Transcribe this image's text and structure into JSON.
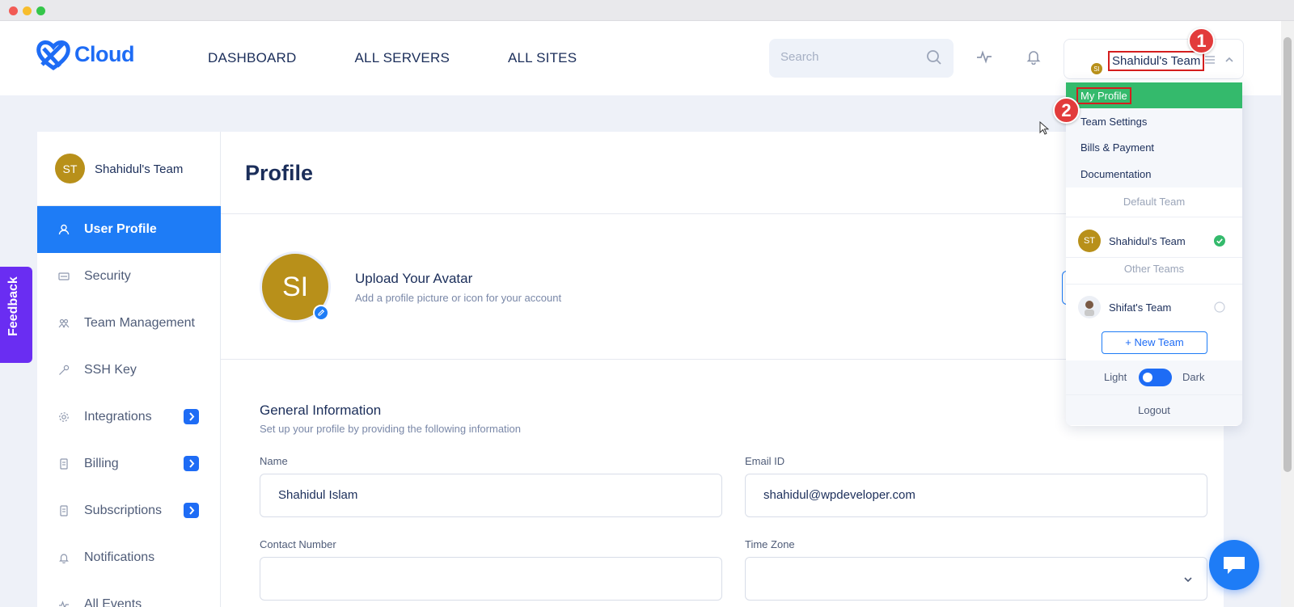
{
  "app": {
    "logo_text": "Cloud"
  },
  "nav": [
    {
      "label": "DASHBOARD"
    },
    {
      "label": "ALL SERVERS"
    },
    {
      "label": "ALL SITES"
    }
  ],
  "search": {
    "placeholder": "Search"
  },
  "user": {
    "initials": "ST",
    "sub_initials": "SI",
    "team_name": "Shahidul's Team"
  },
  "callouts": {
    "one": "1",
    "two": "2"
  },
  "feedback": {
    "label": "Feedback"
  },
  "sidebar": {
    "team_initials": "ST",
    "team_name": "Shahidul's Team",
    "items": [
      {
        "label": "User Profile",
        "icon": "user-icon"
      },
      {
        "label": "Security",
        "icon": "security-icon"
      },
      {
        "label": "Team Management",
        "icon": "team-icon"
      },
      {
        "label": "SSH Key",
        "icon": "key-icon"
      },
      {
        "label": "Integrations",
        "icon": "gear-icon"
      },
      {
        "label": "Billing",
        "icon": "receipt-icon"
      },
      {
        "label": "Subscriptions",
        "icon": "receipt-icon"
      },
      {
        "label": "Notifications",
        "icon": "bell-icon"
      },
      {
        "label": "All Events",
        "icon": "activity-icon"
      }
    ]
  },
  "main": {
    "title": "Profile",
    "avatar_initials": "SI",
    "upload_title": "Upload Your Avatar",
    "upload_sub": "Add a profile picture or icon for your account",
    "general_title": "General Information",
    "general_sub": "Set up your profile by providing the following information",
    "fields": {
      "name_label": "Name",
      "name_value": "Shahidul Islam",
      "email_label": "Email ID",
      "email_value": "shahidul@wpdeveloper.com",
      "contact_label": "Contact Number",
      "contact_value": "",
      "timezone_label": "Time Zone",
      "timezone_value": ""
    }
  },
  "dropdown": {
    "items": [
      {
        "label": "My Profile"
      },
      {
        "label": "Team Settings"
      },
      {
        "label": "Bills & Payment"
      },
      {
        "label": "Documentation"
      }
    ],
    "default_team_heading": "Default Team",
    "default_team": {
      "initials": "ST",
      "name": "Shahidul's Team"
    },
    "other_teams_heading": "Other Teams",
    "other_team": {
      "name": "Shifat's Team"
    },
    "new_team": "+ New Team",
    "theme_light": "Light",
    "theme_dark": "Dark",
    "logout": "Logout"
  },
  "colors": {
    "accent": "#1e7cf6",
    "active_menu": "#34ba6c",
    "avatar": "#b8901a",
    "feedback": "#6a2df2",
    "callout": "#e23b3b"
  }
}
